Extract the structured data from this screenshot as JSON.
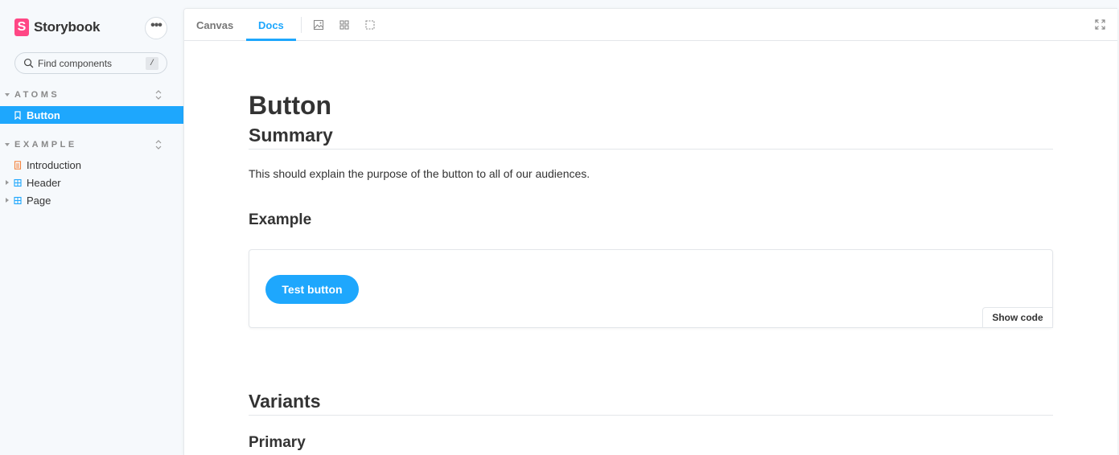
{
  "sidebar": {
    "brand": {
      "logo_letter": "S",
      "name": "Storybook"
    },
    "menu_label": "•••",
    "search": {
      "placeholder": "Find components",
      "shortcut": "/"
    },
    "groups": [
      {
        "label": "ATOMS",
        "items": [
          {
            "label": "Button",
            "icon": "bookmark-icon",
            "selected": true
          }
        ]
      },
      {
        "label": "EXAMPLE",
        "items": [
          {
            "label": "Introduction",
            "icon": "document-icon"
          },
          {
            "label": "Header",
            "icon": "component-icon",
            "expandable": true
          },
          {
            "label": "Page",
            "icon": "component-icon",
            "expandable": true
          }
        ]
      }
    ]
  },
  "toolbar": {
    "tabs": [
      {
        "label": "Canvas"
      },
      {
        "label": "Docs",
        "active": true
      }
    ],
    "tools": [
      "image-icon",
      "grid-icon",
      "outline-icon"
    ],
    "fullscreen": "fullscreen-icon"
  },
  "doc": {
    "title": "Button",
    "summary_heading": "Summary",
    "summary_text": "This should explain the purpose of the button to all of our audiences.",
    "example_heading": "Example",
    "preview_button_label": "Test button",
    "show_code_label": "Show code",
    "variants_heading": "Variants",
    "primary_heading": "Primary"
  },
  "colors": {
    "accent": "#1ea7fd",
    "brand": "#ff4785",
    "sidebar_bg": "#f6f9fc"
  }
}
